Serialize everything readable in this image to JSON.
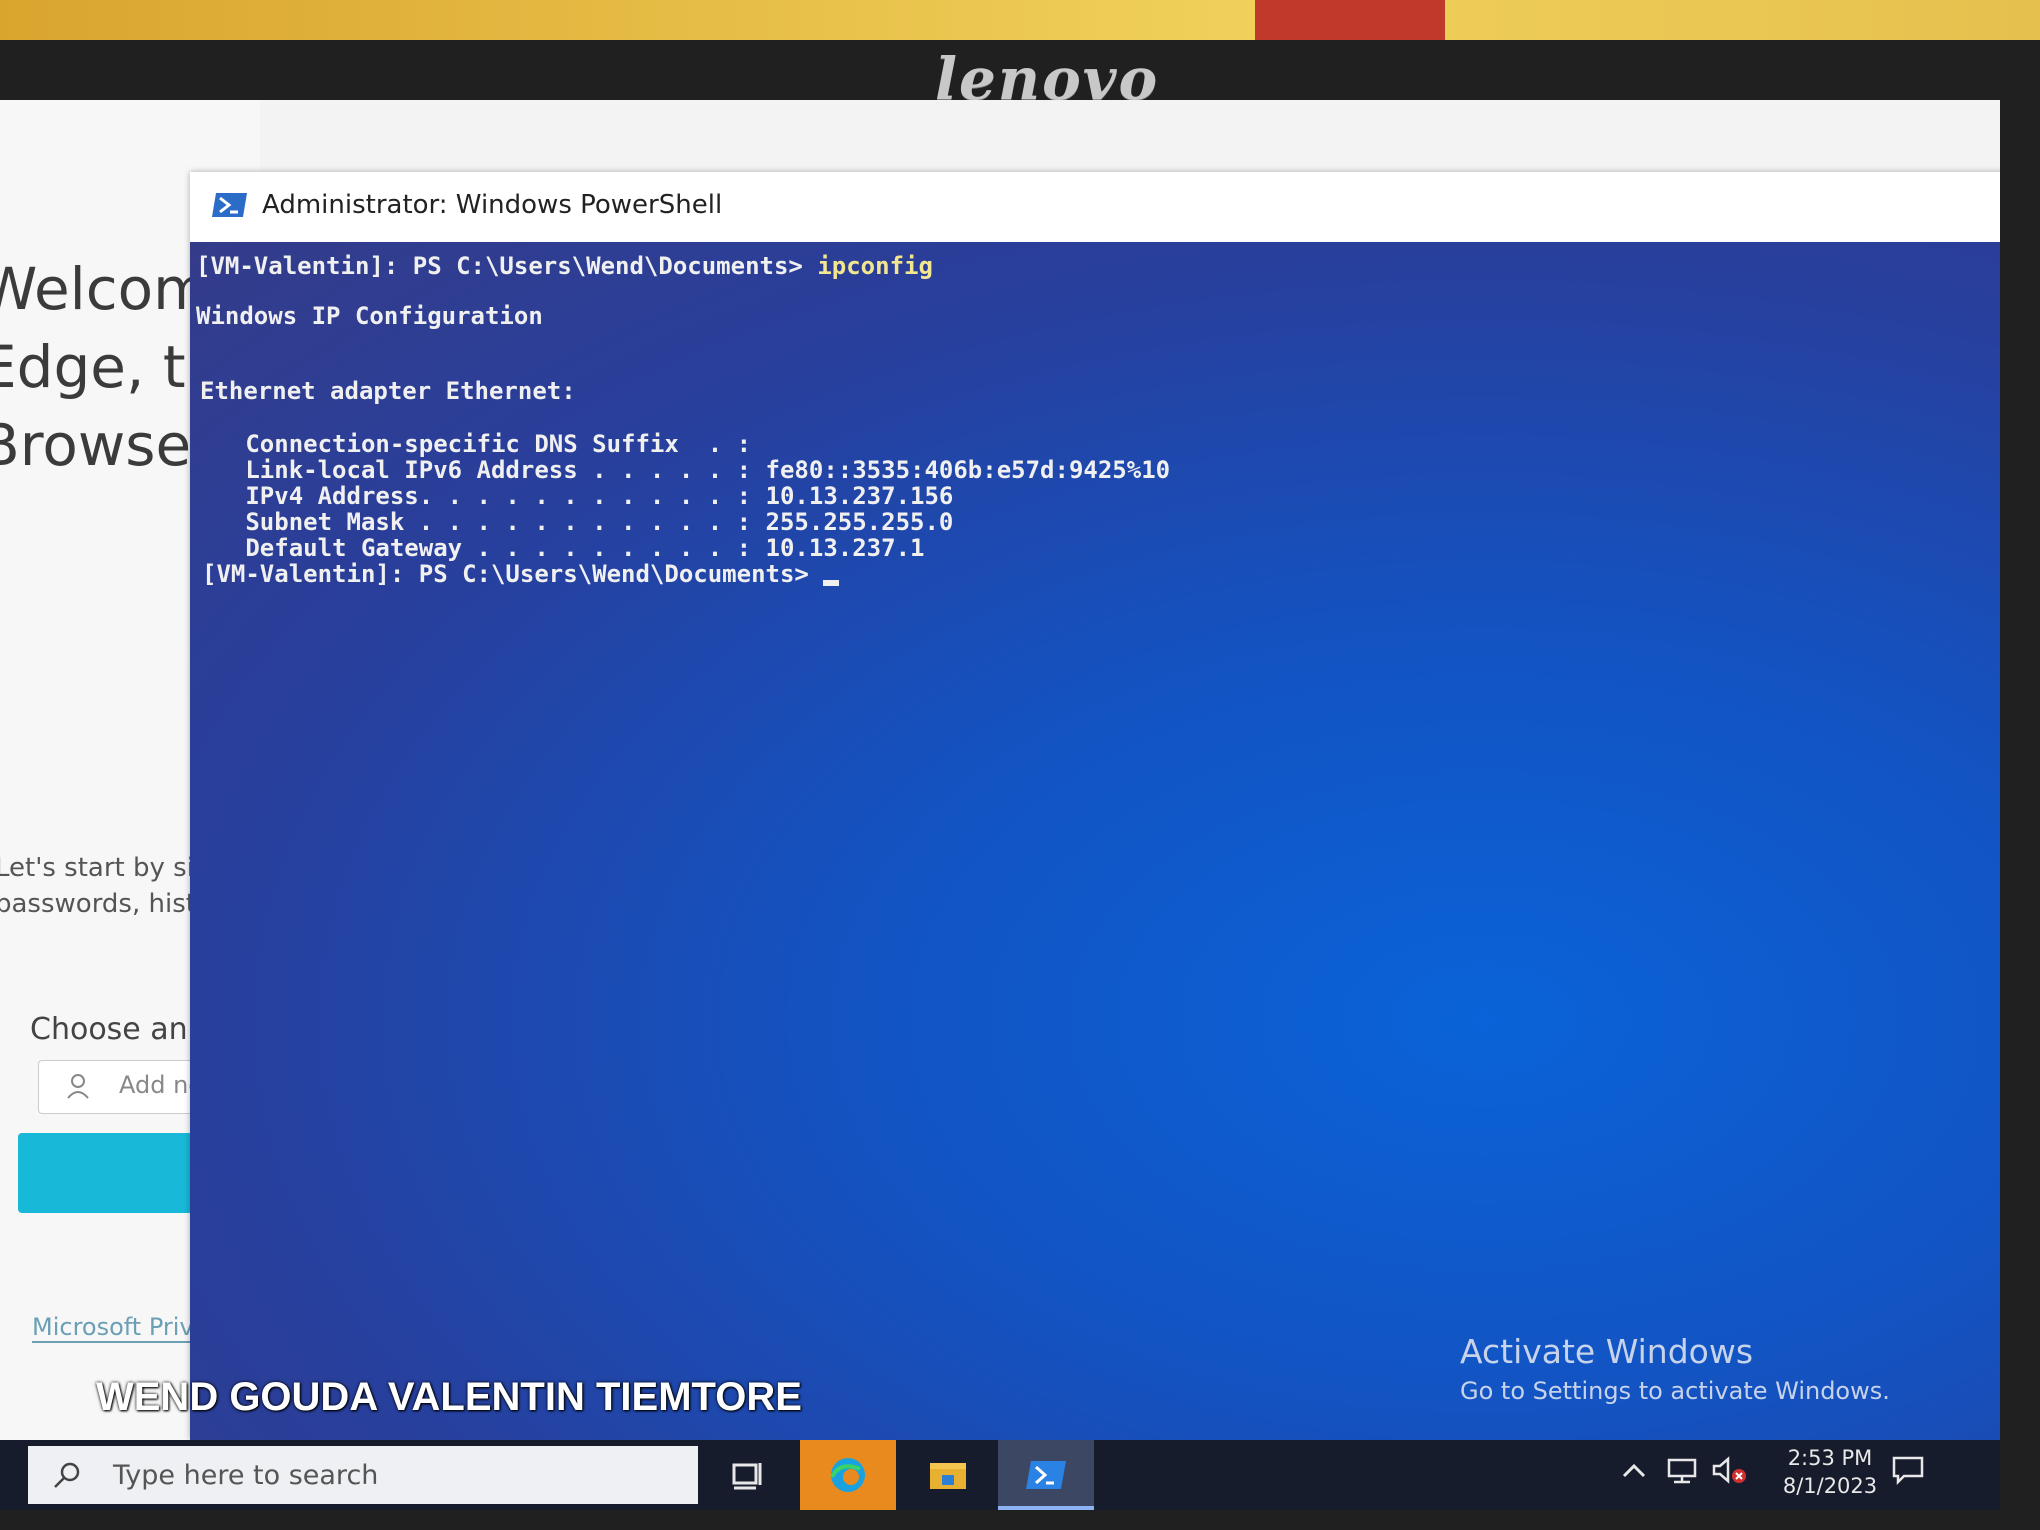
{
  "monitor": {
    "brand": "lenovo"
  },
  "edge_page": {
    "welcome_lines": "Welcom\nEdge, th\nBrowser",
    "intro_lines": "Let's start by sig\npasswords, histo",
    "choose_label": "Choose an a",
    "add_account_label": "Add new a",
    "privacy_link": "Microsoft Privacy"
  },
  "window": {
    "title": "Administrator: Windows PowerShell",
    "minimize_glyph": "—",
    "maximize_glyph": "☐"
  },
  "console": {
    "lines": [
      {
        "text": "[VM-Valentin]: PS C:\\Users\\Wend\\Documents> ",
        "cmd": "ipconfig"
      },
      {
        "text": "Windows IP Configuration"
      },
      {
        "text": "Ethernet adapter Ethernet:"
      },
      {
        "text": "   Connection-specific DNS Suffix  . :"
      },
      {
        "text": "   Link-local IPv6 Address . . . . . : fe80::3535:406b:e57d:9425%10"
      },
      {
        "text": "   IPv4 Address. . . . . . . . . . . : 10.13.237.156"
      },
      {
        "text": "   Subnet Mask . . . . . . . . . . . : 255.255.255.0"
      },
      {
        "text": "   Default Gateway . . . . . . . . . : 10.13.237.1"
      },
      {
        "text": "[VM-Valentin]: PS C:\\Users\\Wend\\Documents> "
      }
    ],
    "activate_title": "Activate Windows",
    "activate_sub": "Go to Settings to activate Windows."
  },
  "taskbar": {
    "search_placeholder": "Type here to search",
    "time": "2:53 PM",
    "date": "8/1/2023",
    "pinned": [
      "task-view-icon",
      "edge-icon",
      "file-explorer-icon",
      "powershell-icon"
    ]
  },
  "overlay": {
    "watermark": "WEND GOUDA VALENTIN TIEMTORE"
  }
}
